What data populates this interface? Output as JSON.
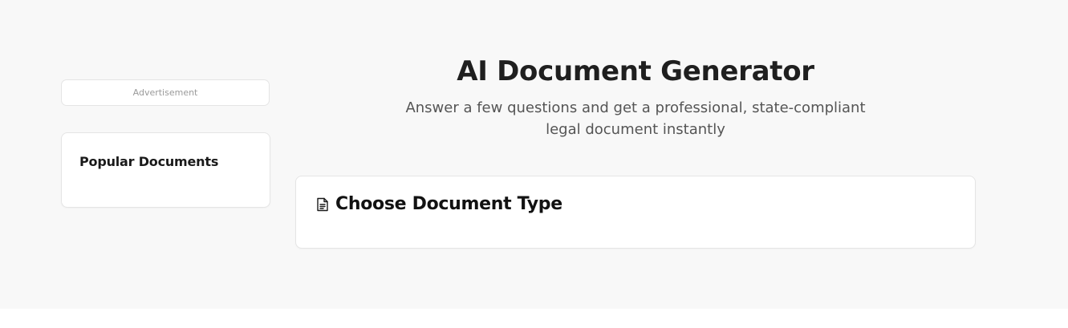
{
  "sidebar": {
    "advertisement_label": "Advertisement",
    "popular_documents_title": "Popular Documents"
  },
  "hero": {
    "title": "AI Document Generator",
    "subtitle": "Answer a few questions and get a professional, state-compliant legal document instantly"
  },
  "document_type_card": {
    "title": "Choose Document Type",
    "icon": "file-text-icon"
  },
  "colors": {
    "page_background": "#f8f8f8",
    "card_background": "#ffffff",
    "card_border": "#e5e5e5",
    "heading_text": "#1f1f1f",
    "subtitle_text": "#555555",
    "ad_label_text": "#9a9a9a"
  }
}
